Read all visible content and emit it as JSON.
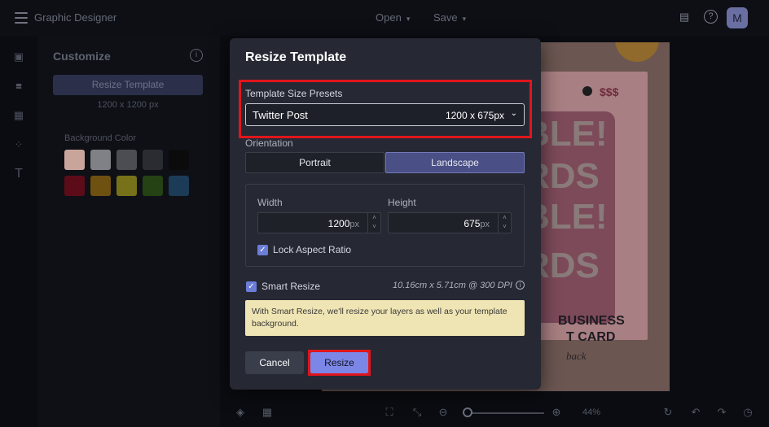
{
  "app": {
    "title": "Graphic Designer",
    "menu_open": "Open",
    "menu_save": "Save",
    "avatar_initial": "M"
  },
  "panel": {
    "title": "Customize",
    "resize_button": "Resize Template",
    "size_text": "1200 x 1200 px",
    "bg_label": "Background Color",
    "swatches": [
      "#c8a49a",
      "#7f8187",
      "#4b4d52",
      "#2a2c31",
      "#0b0b0c",
      "#5c0c18",
      "#6e5010",
      "#77711a",
      "#244213",
      "#1b3b57"
    ]
  },
  "modal": {
    "title": "Resize Template",
    "presets_label": "Template Size Presets",
    "preset_name": "Twitter Post",
    "preset_size": "1200 x 675px",
    "orientation_label": "Orientation",
    "portrait": "Portrait",
    "landscape": "Landscape",
    "width_label": "Width",
    "width_value": "1200",
    "height_label": "Height",
    "height_value": "675",
    "unit": "px",
    "lock_label": "Lock Aspect Ratio",
    "smart_label": "Smart Resize",
    "smart_dims": "10.16cm x 5.71cm @ 300 DPI",
    "note": "With Smart Resize, we'll resize your layers as well as your template background.",
    "cancel": "Cancel",
    "resize": "Resize"
  },
  "artboard": {
    "money": "$$$",
    "line1": "BLE!",
    "line2": "RDS",
    "line3": "BLE!",
    "line4": "RDS",
    "business": "BUSINESS",
    "card": "T CARD",
    "back": "back"
  },
  "bottom": {
    "zoom": "44%"
  },
  "colors": {
    "accent": "#7b86e6",
    "highlight": "#e0151c"
  }
}
